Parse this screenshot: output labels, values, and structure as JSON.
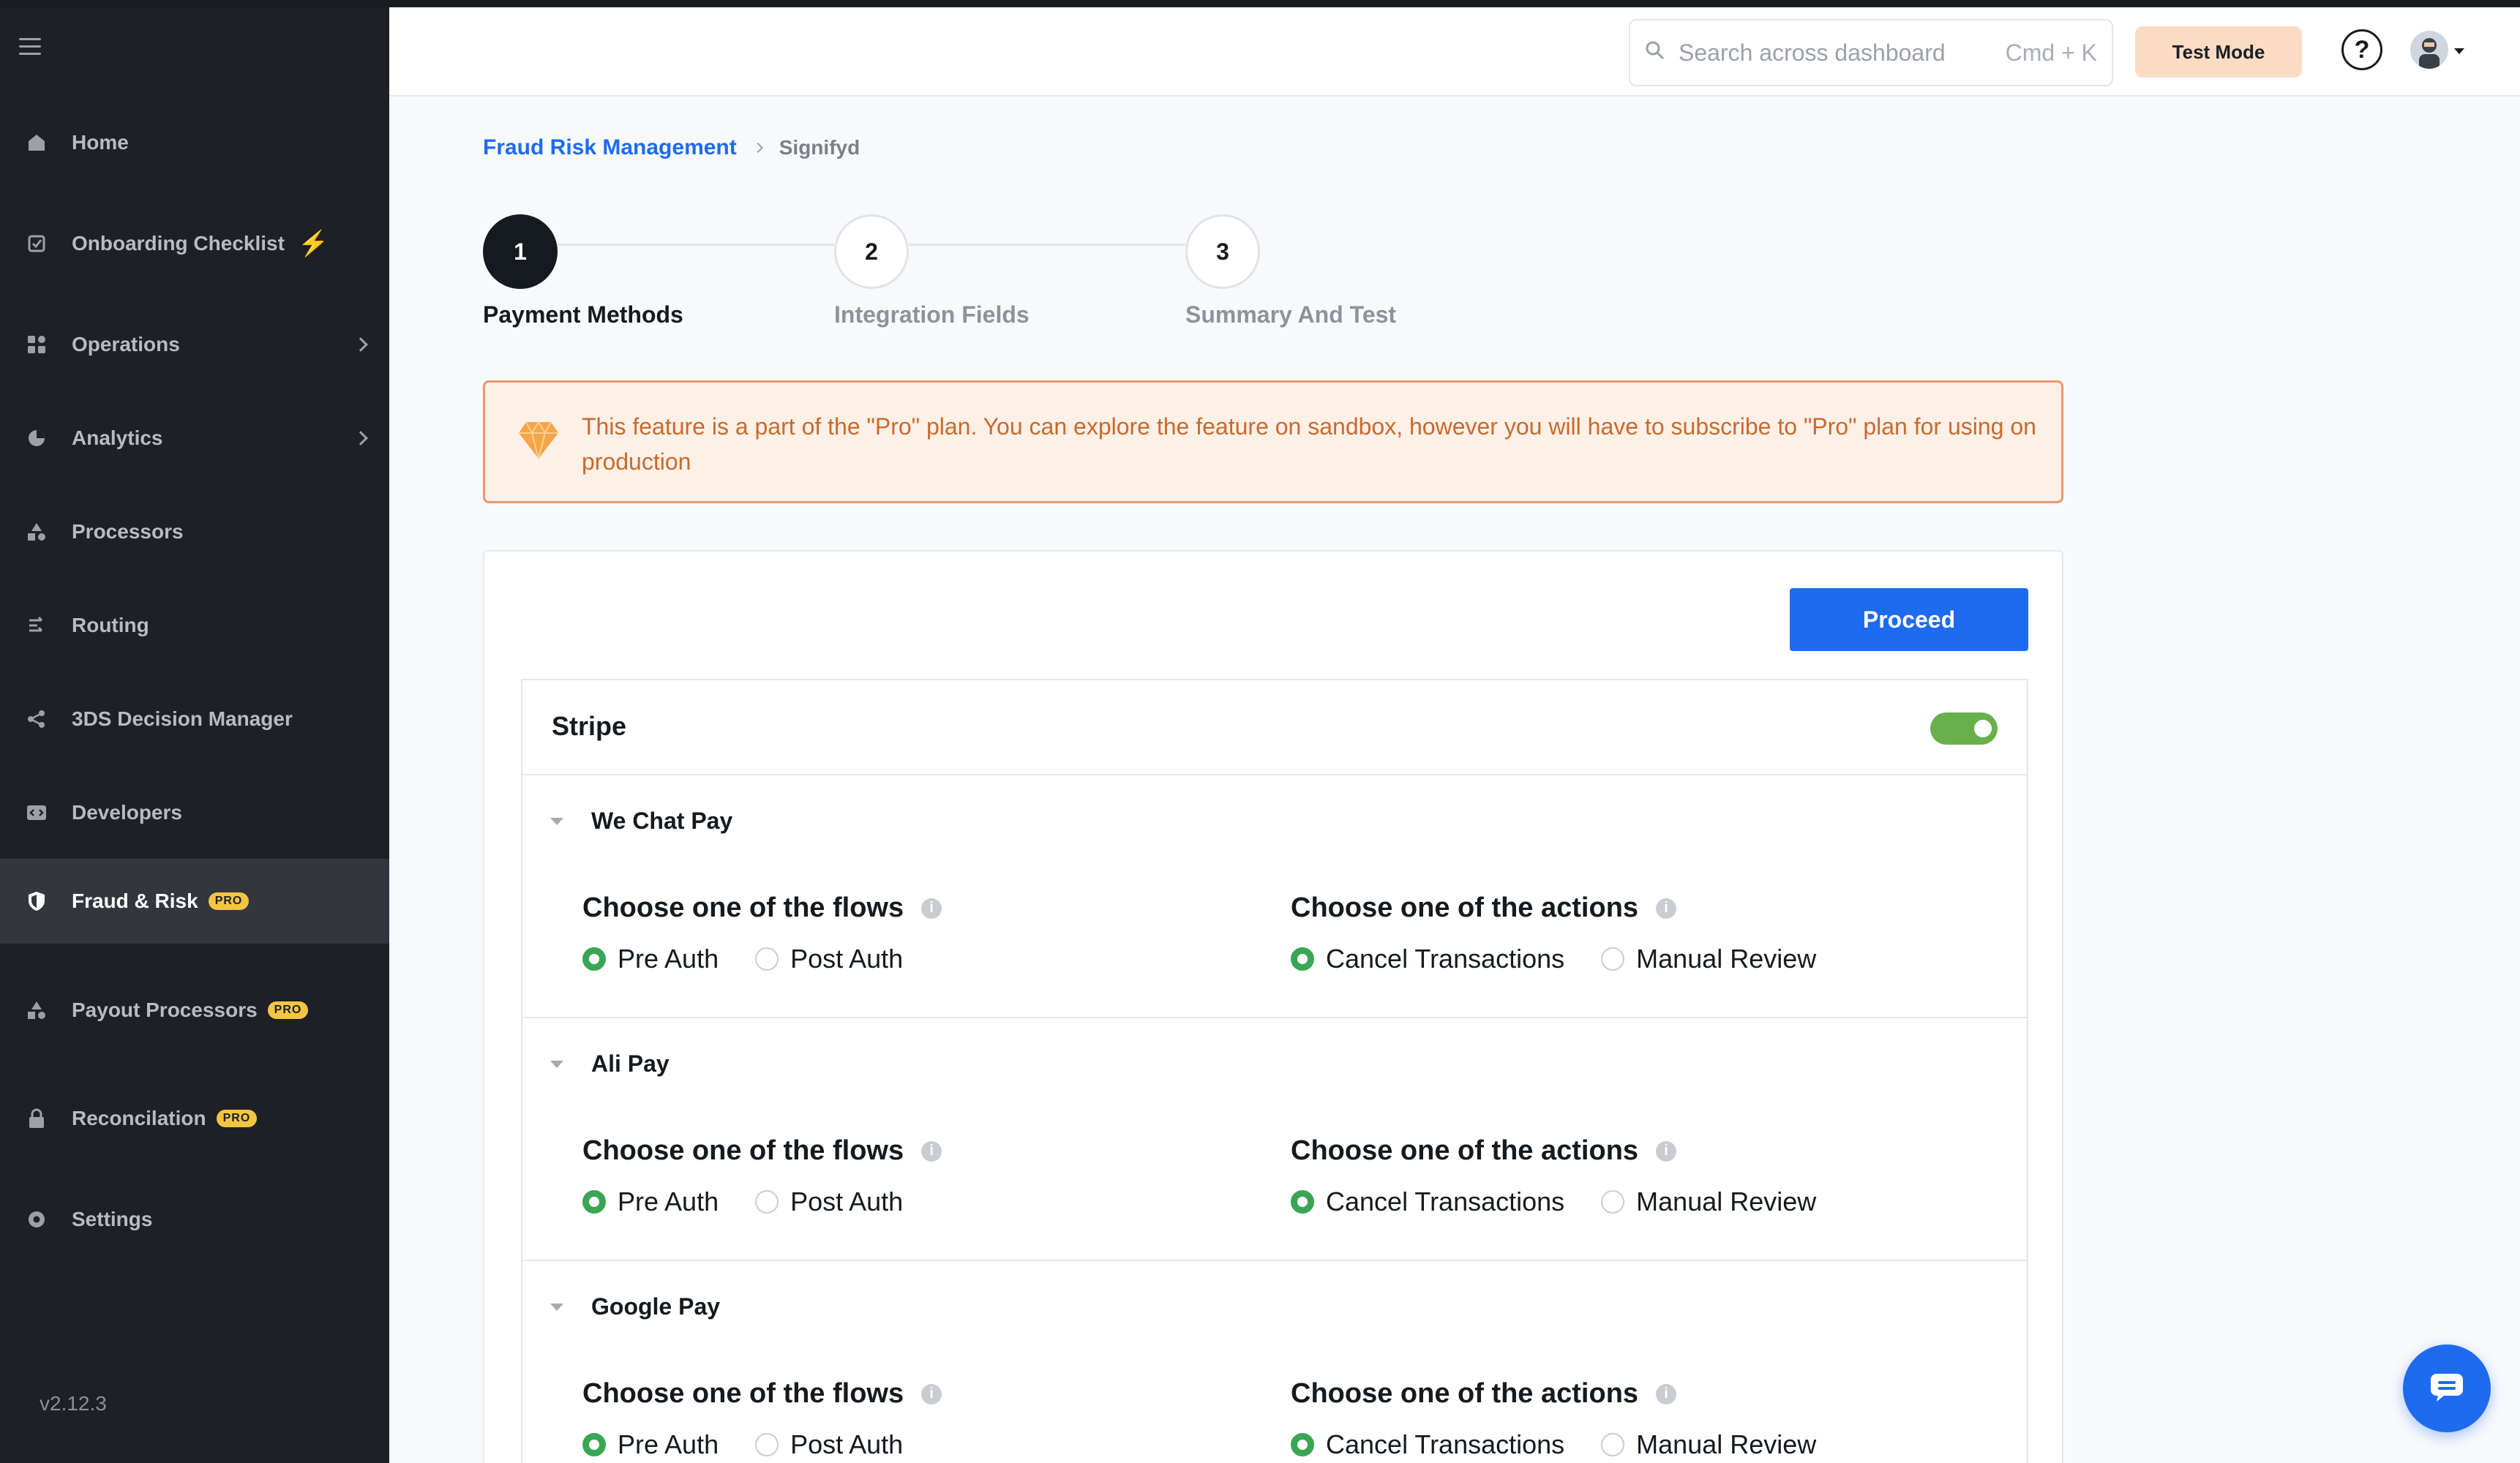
{
  "sidebar": {
    "items": [
      {
        "label": "Home",
        "icon": "home-icon"
      },
      {
        "label": "Onboarding Checklist",
        "icon": "checklist-icon"
      },
      {
        "label": "Operations",
        "icon": "operations-icon"
      },
      {
        "label": "Analytics",
        "icon": "analytics-icon"
      },
      {
        "label": "Processors",
        "icon": "processors-icon"
      },
      {
        "label": "Routing",
        "icon": "routing-icon"
      },
      {
        "label": "3DS Decision Manager",
        "icon": "share-icon"
      },
      {
        "label": "Developers",
        "icon": "developers-icon"
      },
      {
        "label": "Fraud & Risk",
        "icon": "shield-icon",
        "badge": "PRO",
        "active": true
      },
      {
        "label": "Payout Processors",
        "icon": "payout-icon",
        "badge": "PRO"
      },
      {
        "label": "Reconcilation",
        "icon": "lock-icon",
        "badge": "PRO"
      },
      {
        "label": "Settings",
        "icon": "gear-icon"
      }
    ],
    "version": "v2.12.3"
  },
  "header": {
    "search_placeholder": "Search across dashboard",
    "search_shortcut": "Cmd + K",
    "test_mode_label": "Test Mode",
    "help_label": "?"
  },
  "breadcrumb": {
    "parent": "Fraud Risk Management",
    "current": "Signifyd"
  },
  "stepper": {
    "steps": [
      {
        "number": "1",
        "label": "Payment Methods",
        "state": "active"
      },
      {
        "number": "2",
        "label": "Integration Fields",
        "state": "pending"
      },
      {
        "number": "3",
        "label": "Summary And Test",
        "state": "pending"
      }
    ]
  },
  "alert": {
    "message": "This feature is a part of the \"Pro\" plan. You can explore the feature on sandbox, however you will have to subscribe to \"Pro\" plan for using on production"
  },
  "form": {
    "proceed_label": "Proceed",
    "processor_name": "Stripe",
    "processor_enabled": true,
    "flows_title": "Choose one of the flows",
    "actions_title": "Choose one of the actions",
    "flow_options": [
      "Pre Auth",
      "Post Auth"
    ],
    "action_options": [
      "Cancel Transactions",
      "Manual Review"
    ],
    "payment_methods": [
      {
        "name": "We Chat Pay",
        "selected_flow": "Pre Auth",
        "selected_action": "Cancel Transactions"
      },
      {
        "name": "Ali Pay",
        "selected_flow": "Pre Auth",
        "selected_action": "Cancel Transactions"
      },
      {
        "name": "Google Pay",
        "selected_flow": "Pre Auth",
        "selected_action": "Cancel Transactions"
      }
    ]
  },
  "colors": {
    "primary": "#1e6bf0",
    "sidebar_bg": "#1e2025",
    "success": "#3aa655",
    "toggle_on": "#68b04c",
    "alert_text": "#c96a2c",
    "pro_badge": "#f5c542"
  }
}
